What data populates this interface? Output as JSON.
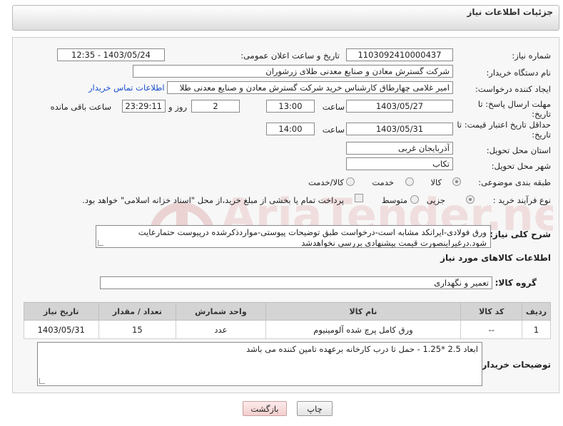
{
  "header": {
    "title": "جزئیات اطلاعات نیاز"
  },
  "fields": {
    "need_number": {
      "label": "شماره نیاز:",
      "value": "1103092410000437"
    },
    "announce_datetime": {
      "label": "تاریخ و ساعت اعلان عمومی:",
      "value": "1403/05/24 - 12:35"
    },
    "buyer_org": {
      "label": "نام دستگاه خریدار:",
      "value": "شرکت گسترش معادن و صنایع معدنی طلای زرشوران"
    },
    "requester": {
      "label": "ایجاد کننده درخواست:",
      "value": "امیر  غلامی چهارطاق کارشناس خرید شرکت گسترش معادن و صنایع معدنی طلا",
      "contact_link": "اطلاعات تماس خریدار"
    },
    "reply_deadline": {
      "label_line1": "مهلت ارسال پاسخ: تا",
      "label_line2": "تاریخ:",
      "date": "1403/05/27",
      "time_label": "ساعت",
      "time": "13:00",
      "days": "2",
      "days_label": "روز و",
      "remaining": "23:29:11",
      "remaining_label": "ساعت باقی مانده"
    },
    "price_validity": {
      "label_line1": "حداقل تاریخ اعتبار قیمت: تا",
      "label_line2": "تاریخ:",
      "date": "1403/05/31",
      "time_label": "ساعت",
      "time": "14:00"
    },
    "delivery_province": {
      "label": "استان محل تحویل:",
      "value": "آذربایجان غربی"
    },
    "delivery_city": {
      "label": "شهر محل تحویل:",
      "value": "تکاب"
    },
    "subject_class": {
      "label": "طبقه بندی موضوعی:",
      "options": [
        "کالا",
        "خدمت",
        "کالا/خدمت"
      ],
      "selected": "کالا"
    },
    "purchase_type": {
      "label": "نوع فرآیند خرید :",
      "options": [
        "جزیی",
        "متوسط"
      ],
      "selected": "جزیی",
      "payment_note": "پرداخت تمام یا بخشی از مبلغ خرید،از محل \"اسناد خزانه اسلامی\" خواهد بود."
    }
  },
  "description": {
    "label": "شرح کلی نیاز:",
    "line1": "ورق فولادی-ایرانکد مشابه است-درخواست طبق توضیحات پیوستی-مواردذکرشده درپیوست حتمارعایت",
    "line2": "شود.درغیراینصورت قیمت پیشنهادی بررسی نخواهدشد"
  },
  "goods_section": {
    "title": "اطلاعات کالاهای مورد نیاز",
    "group_label": "گروه کالا:",
    "group_value": "تعمیر و نگهداری"
  },
  "table": {
    "headers": [
      "ردیف",
      "کد کالا",
      "نام کالا",
      "واحد شمارش",
      "تعداد / مقدار",
      "تاریخ نیاز"
    ],
    "rows": [
      [
        "1",
        "--",
        "ورق کامل پرچ شده آلومینیوم",
        "عدد",
        "15",
        "1403/05/31"
      ]
    ]
  },
  "buyer_notes": {
    "label": "توضیحات خریدار:",
    "value": "ابعاد 2.5 *1.25 - حمل تا درب کارخانه برعهده تامین کننده می باشد"
  },
  "buttons": {
    "print": "چاپ",
    "back": "بازگشت"
  },
  "watermark": {
    "text": "AriaTender.neT"
  },
  "colors": {
    "link": "#1a4fd0",
    "header_bg": "#dedede",
    "table_header": "#d4d4d4",
    "back_button": "#f3cfcf",
    "watermark": "#e8c8c8"
  }
}
